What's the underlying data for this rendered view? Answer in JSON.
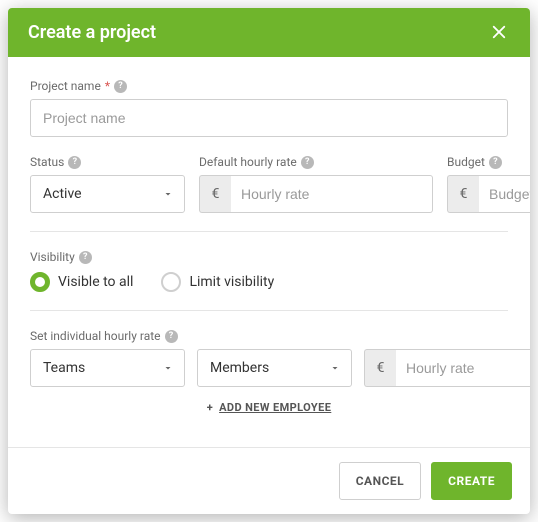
{
  "header": {
    "title": "Create a project"
  },
  "project_name": {
    "label": "Project name",
    "placeholder": "Project name",
    "value": ""
  },
  "status": {
    "label": "Status",
    "selected": "Active"
  },
  "default_hourly": {
    "label": "Default hourly rate",
    "currency": "€",
    "placeholder": "Hourly rate",
    "value": ""
  },
  "budget": {
    "label": "Budget",
    "currency": "€",
    "placeholder": "Budget",
    "value": ""
  },
  "visibility": {
    "label": "Visibility",
    "options": {
      "all": "Visible to all",
      "limit": "Limit visibility"
    },
    "selected": "all"
  },
  "individual": {
    "label": "Set individual hourly rate",
    "teams": {
      "selected": "Teams"
    },
    "members": {
      "selected": "Members"
    },
    "rate": {
      "currency": "€",
      "placeholder": "Hourly rate",
      "value": ""
    },
    "add_label": "ADD NEW EMPLOYEE"
  },
  "footer": {
    "cancel": "CANCEL",
    "create": "CREATE"
  }
}
